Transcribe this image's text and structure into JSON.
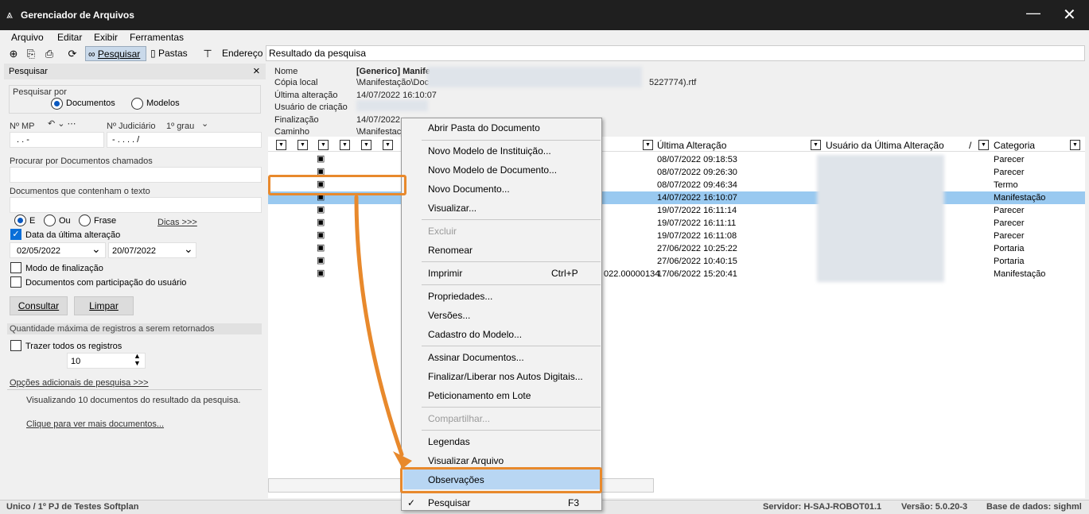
{
  "window": {
    "title": "Gerenciador de Arquivos",
    "minimize": "—",
    "close": "✕"
  },
  "menu": [
    "Arquivo",
    "Editar",
    "Exibir",
    "Ferramentas"
  ],
  "toolbar": {
    "pesquisar": "Pesquisar",
    "pastas": "Pastas",
    "endereco": "Endereço",
    "address_value": "Resultado da pesquisa"
  },
  "left": {
    "header": "Pesquisar",
    "close": "×",
    "pesquisar_por": "Pesquisar por",
    "documentos": "Documentos",
    "modelos": "Modelos",
    "nmp": "Nº MP",
    "nmp_value": ".  .  -",
    "njud": "Nº Judiciário",
    "grau": "1º grau",
    "njud_value": "-  .  .  .  .  /",
    "procurar_label": "Procurar por Documentos chamados",
    "contenham_label": "Documentos que contenham o texto",
    "e": "E",
    "ou": "Ou",
    "frase": "Frase",
    "dicas": "Dicas >>>",
    "data_ult": "Data da última alteração",
    "date_from": "02/05/2022",
    "date_to": "20/07/2022",
    "modo_final": "Modo de finalização",
    "doc_part": "Documentos com participação do usuário",
    "consultar": "Consultar",
    "limpar": "Limpar",
    "qtd_max": "Quantidade máxima de registros a serem retornados",
    "trazer": "Trazer todos os registros",
    "qtd_value": "10",
    "opcoes": "Opções adicionais de pesquisa >>>",
    "visualizando": "Visualizando 10 documentos do resultado da pesquisa.",
    "clique": "Clique para ver mais documentos..."
  },
  "details": {
    "labels": [
      "Nome",
      "Cópia local",
      "Última alteração",
      "Usuário de criação",
      "Finalização",
      "Caminho"
    ],
    "values": [
      "[Generico] Manife",
      "\\Manifestação\\Doc",
      "14/07/2022 16:10:07",
      "",
      "14/07/2022",
      "\\Manifestac"
    ],
    "copia_suffix": "5227774).rtf"
  },
  "grid": {
    "headers": {
      "ult_alt": "Última Alteração",
      "usuario": "Usuário da Última Alteração",
      "sort": "/",
      "categoria": "Categoria"
    },
    "rows": [
      {
        "date": "08/07/2022 09:18:53",
        "cat": "Parecer",
        "pre": "",
        "sel": false
      },
      {
        "date": "08/07/2022 09:26:30",
        "cat": "Parecer",
        "pre": "",
        "sel": false
      },
      {
        "date": "08/07/2022 09:46:34",
        "cat": "Termo",
        "pre": "",
        "sel": false
      },
      {
        "date": "14/07/2022 16:10:07",
        "cat": "Manifestação",
        "pre": "",
        "sel": true
      },
      {
        "date": "19/07/2022 16:11:14",
        "cat": "Parecer",
        "pre": "",
        "sel": false
      },
      {
        "date": "19/07/2022 16:11:11",
        "cat": "Parecer",
        "pre": "",
        "sel": false
      },
      {
        "date": "19/07/2022 16:11:08",
        "cat": "Parecer",
        "pre": "",
        "sel": false
      },
      {
        "date": "27/06/2022 10:25:22",
        "cat": "Portaria",
        "pre": "",
        "sel": false
      },
      {
        "date": "27/06/2022 10:40:15",
        "cat": "Portaria",
        "pre": "",
        "sel": false
      },
      {
        "date": "17/06/2022 15:20:41",
        "cat": "Manifestação",
        "pre": "022.00000134",
        "sel": false
      }
    ]
  },
  "context_menu": {
    "items": [
      {
        "label": "Abrir Pasta do Documento",
        "disabled": false
      },
      {
        "label": "Novo Modelo de Instituição...",
        "disabled": false
      },
      {
        "label": "Novo Modelo de Documento...",
        "disabled": false
      },
      {
        "label": "Novo Documento...",
        "disabled": false
      },
      {
        "label": "Visualizar...",
        "disabled": false
      },
      {
        "label": "Excluir",
        "disabled": true
      },
      {
        "label": "Renomear",
        "disabled": false
      },
      {
        "label": "Imprimir",
        "disabled": false,
        "shortcut": "Ctrl+P"
      },
      {
        "label": "Propriedades...",
        "disabled": false
      },
      {
        "label": "Versões...",
        "disabled": false
      },
      {
        "label": "Cadastro do Modelo...",
        "disabled": false
      },
      {
        "label": "Assinar Documentos...",
        "disabled": false
      },
      {
        "label": "Finalizar/Liberar nos Autos Digitais...",
        "disabled": false
      },
      {
        "label": "Peticionamento em Lote",
        "disabled": false
      },
      {
        "label": "Compartilhar...",
        "disabled": true
      },
      {
        "label": "Legendas",
        "disabled": false
      },
      {
        "label": "Visualizar Arquivo",
        "disabled": false
      },
      {
        "label": "Observações",
        "disabled": false,
        "highlighted": true
      },
      {
        "label": "Pesquisar",
        "disabled": false,
        "shortcut": "F3",
        "checked": true
      }
    ]
  },
  "status": {
    "left": "Unico / 1º PJ de Testes Softplan",
    "servidor": "Servidor: H-SAJ-ROBOT01.1",
    "versao": "Versão: 5.0.20-3",
    "base": "Base de dados: sighml"
  },
  "colors": {
    "accent": "#e8892c",
    "selection": "#99c9f0",
    "highlight": "#b8d6f3",
    "titlebar": "#1f1f1f"
  }
}
